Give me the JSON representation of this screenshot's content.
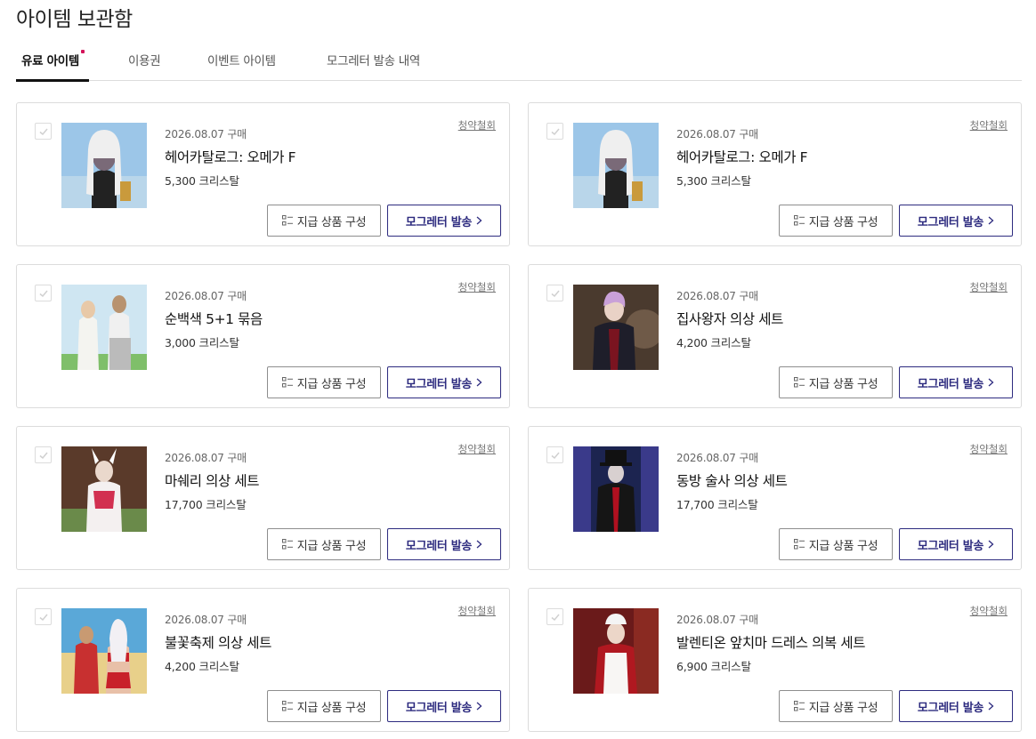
{
  "page_title": "아이템 보관함",
  "tabs": [
    {
      "label": "유료 아이템",
      "active": true,
      "has_dot": true
    },
    {
      "label": "이용권",
      "active": false
    },
    {
      "label": "이벤트 아이템",
      "active": false
    },
    {
      "label": "모그레터 발송 내역",
      "active": false
    }
  ],
  "colors": {
    "accent": "#2d2b7f",
    "dot": "#d4145a",
    "border": "#dcdcdc"
  },
  "items": [
    {
      "date": "2026.08.07 구매",
      "name": "헤어카탈로그: 오메가 F",
      "price": "5,300 크리스탈",
      "cancel": "청약철회",
      "contents_label": "지급 상품 구성",
      "send_label": "모그레터 발송",
      "image": "hair-catalog-thumbnail"
    },
    {
      "date": "2026.08.07 구매",
      "name": "헤어카탈로그: 오메가 F",
      "price": "5,300 크리스탈",
      "cancel": "청약철회",
      "contents_label": "지급 상품 구성",
      "send_label": "모그레터 발송",
      "image": "hair-catalog-thumbnail"
    },
    {
      "date": "2026.08.07 구매",
      "name": "순백색 5+1 묶음",
      "price": "3,000 크리스탈",
      "cancel": "청약철회",
      "contents_label": "지급 상품 구성",
      "send_label": "모그레터 발송",
      "image": "white-outfit-thumbnail"
    },
    {
      "date": "2026.08.07 구매",
      "name": "집사왕자 의상 세트",
      "price": "4,200 크리스탈",
      "cancel": "청약철회",
      "contents_label": "지급 상품 구성",
      "send_label": "모그레터 발송",
      "image": "butler-outfit-thumbnail"
    },
    {
      "date": "2026.08.07 구매",
      "name": "마쉐리 의상 세트",
      "price": "17,700 크리스탈",
      "cancel": "청약철회",
      "contents_label": "지급 상품 구성",
      "send_label": "모그레터 발송",
      "image": "macherie-outfit-thumbnail"
    },
    {
      "date": "2026.08.07 구매",
      "name": "동방 술사 의상 세트",
      "price": "17,700 크리스탈",
      "cancel": "청약철회",
      "contents_label": "지급 상품 구성",
      "send_label": "모그레터 발송",
      "image": "eastern-mage-outfit-thumbnail"
    },
    {
      "date": "2026.08.07 구매",
      "name": "불꽃축제 의상 세트",
      "price": "4,200 크리스탈",
      "cancel": "청약철회",
      "contents_label": "지급 상품 구성",
      "send_label": "모그레터 발송",
      "image": "festival-outfit-thumbnail"
    },
    {
      "date": "2026.08.07 구매",
      "name": "발렌티온 앞치마 드레스 의복 세트",
      "price": "6,900 크리스탈",
      "cancel": "청약철회",
      "contents_label": "지급 상품 구성",
      "send_label": "모그레터 발송",
      "image": "valentione-dress-thumbnail"
    }
  ]
}
